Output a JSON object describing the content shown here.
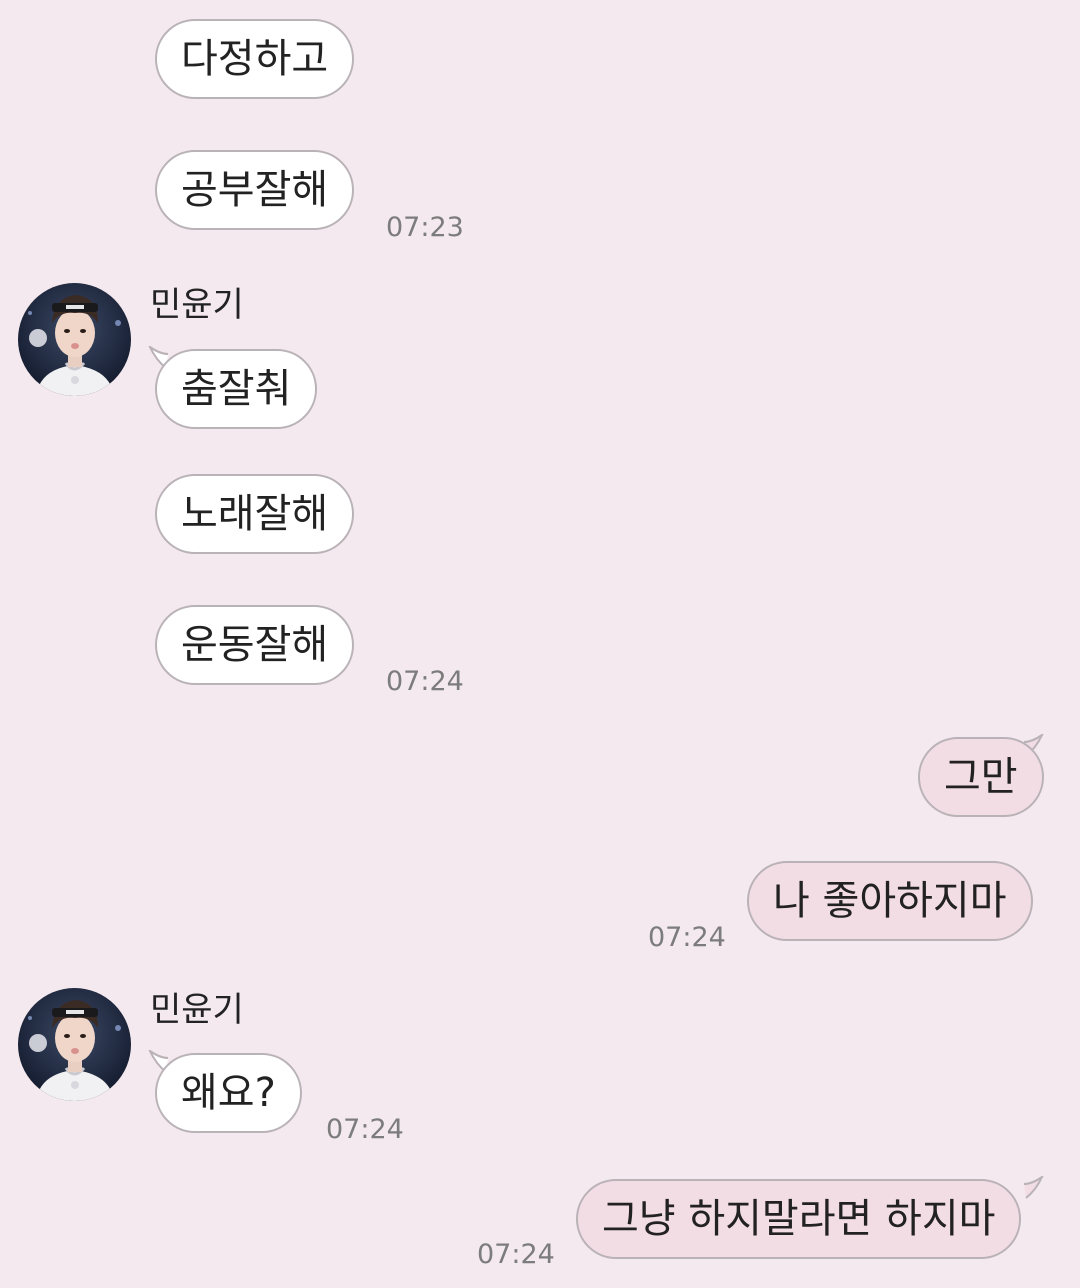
{
  "contact": {
    "name": "민윤기",
    "avatar_icon": "profile-photo-avatar"
  },
  "colors": {
    "background": "#f4e9ee",
    "incoming_bubble": "#ffffff",
    "outgoing_bubble": "#f3dde5",
    "bubble_border": "#b9b2b6",
    "timestamp": "#7c7c7c"
  },
  "messages": [
    {
      "direction": "in",
      "text": "다정하고"
    },
    {
      "direction": "in",
      "text": "공부잘해",
      "time": "07:23"
    },
    {
      "direction": "in",
      "text": "춤잘춰"
    },
    {
      "direction": "in",
      "text": "노래잘해"
    },
    {
      "direction": "in",
      "text": "운동잘해",
      "time": "07:24"
    },
    {
      "direction": "out",
      "text": "그만"
    },
    {
      "direction": "out",
      "text": "나 좋아하지마",
      "time": "07:24"
    },
    {
      "direction": "in",
      "text": "왜요?",
      "time": "07:24"
    },
    {
      "direction": "out",
      "text": "그냥 하지말라면 하지마",
      "time": "07:24"
    }
  ]
}
